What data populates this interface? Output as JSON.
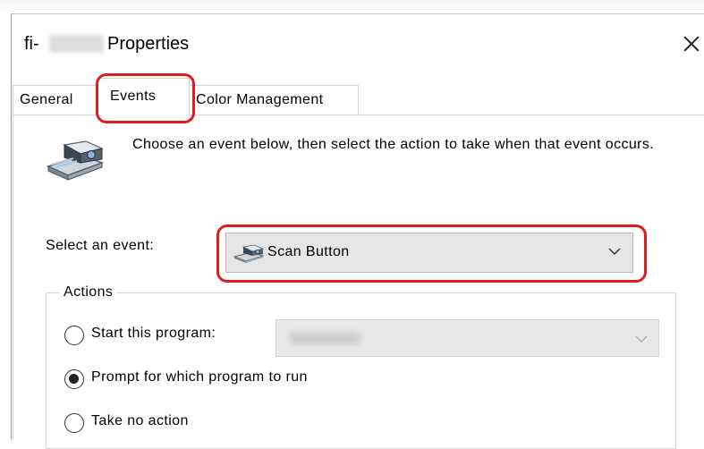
{
  "window": {
    "title_prefix": "fi-",
    "title_suffix": "Properties"
  },
  "tabs": [
    {
      "label": "General",
      "selected": false
    },
    {
      "label": "Events",
      "selected": true
    },
    {
      "label": "Color Management",
      "selected": false
    }
  ],
  "events_tab": {
    "description": "Choose an event below, then select the action to take when that event occurs.",
    "select_event_label": "Select an event:",
    "selected_event": "Scan Button",
    "selected_event_icon": "scanner-icon",
    "actions": {
      "legend": "Actions",
      "options": [
        {
          "label": "Start this program:",
          "checked": false
        },
        {
          "label": "Prompt for which program to run",
          "checked": true
        },
        {
          "label": "Take no action",
          "checked": false
        }
      ]
    }
  },
  "colors": {
    "highlight": "#e21c1c",
    "select_bg": "#e6e6e6"
  }
}
